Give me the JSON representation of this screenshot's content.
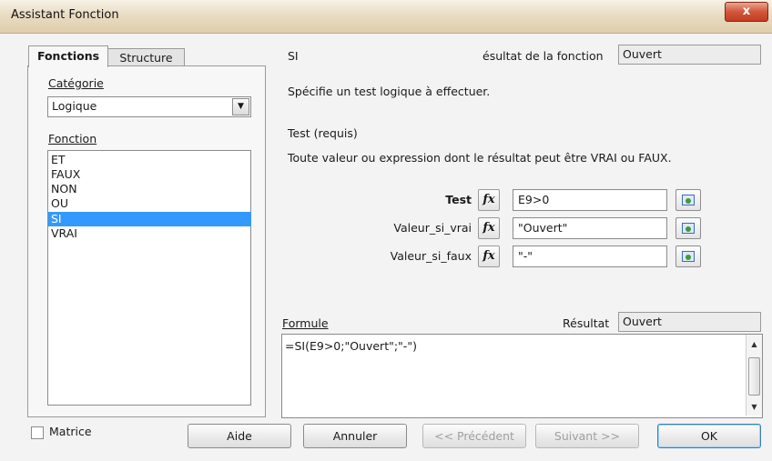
{
  "window": {
    "title": "Assistant Fonction",
    "close_label": "x"
  },
  "tabs": [
    {
      "label": "Fonctions"
    },
    {
      "label": "Structure"
    }
  ],
  "category": {
    "label": "Catégorie",
    "value": "Logique"
  },
  "function_list": {
    "label": "Fonction",
    "items": [
      "ET",
      "FAUX",
      "NON",
      "OU",
      "SI",
      "VRAI"
    ],
    "selected": "SI"
  },
  "header": {
    "function_name": "SI",
    "result_label": "ésultat de la fonction",
    "result_value": "Ouvert"
  },
  "description": "Spécifie un test logique à effectuer.",
  "argument": {
    "name": "Test (requis)",
    "description": "Toute valeur ou expression dont le résultat peut être VRAI ou FAUX."
  },
  "params": [
    {
      "label": "Test",
      "value": "E9>0"
    },
    {
      "label": "Valeur_si_vrai",
      "value": "\"Ouvert\""
    },
    {
      "label": "Valeur_si_faux",
      "value": "\"-\""
    }
  ],
  "fx_glyph": "fx",
  "formula": {
    "label": "Formule",
    "value": "=SI(E9>0;\"Ouvert\";\"-\")"
  },
  "result": {
    "label": "Résultat",
    "value": "Ouvert"
  },
  "matrix": {
    "label": "Matrice",
    "checked": false
  },
  "buttons": {
    "help": "Aide",
    "cancel": "Annuler",
    "previous": "<< Précédent",
    "next": "Suivant >>",
    "ok": "OK"
  },
  "icons": {
    "dropdown": "chevron-down-icon",
    "shrink": "shrink-dialog-icon"
  }
}
